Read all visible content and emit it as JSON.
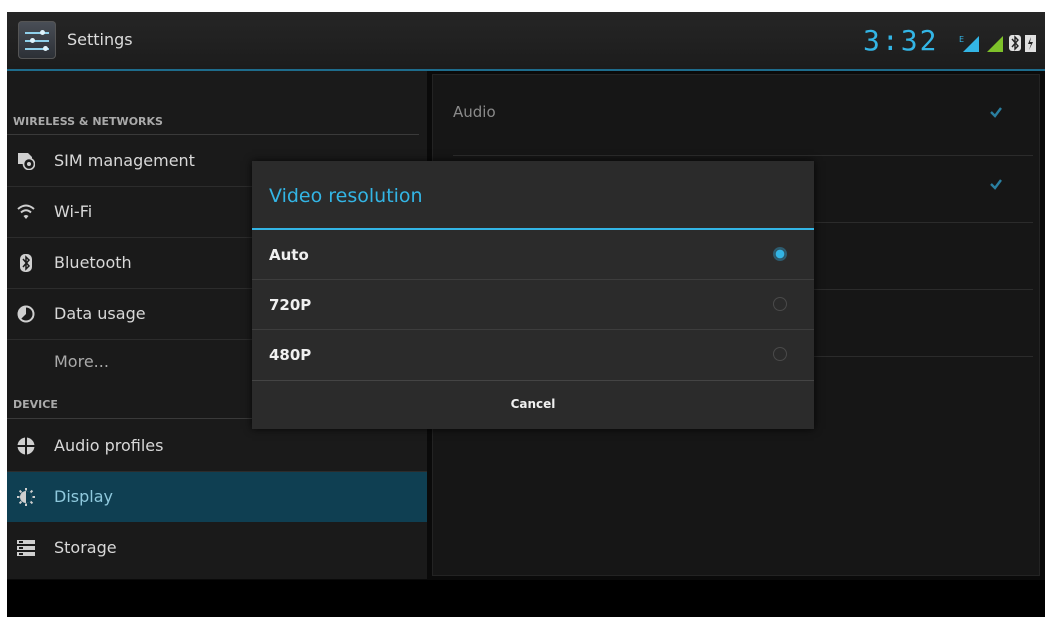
{
  "action_bar": {
    "title": "Settings",
    "clock": "3:32"
  },
  "sidebar": {
    "section_wireless": "WIRELESS & NETWORKS",
    "section_device": "DEVICE",
    "items": [
      {
        "label": "SIM management",
        "icon": "sim-icon"
      },
      {
        "label": "Wi-Fi",
        "icon": "wifi-icon"
      },
      {
        "label": "Bluetooth",
        "icon": "bluetooth-icon"
      },
      {
        "label": "Data usage",
        "icon": "data-usage-icon"
      },
      {
        "label": "More...",
        "icon": ""
      },
      {
        "label": "Audio profiles",
        "icon": "audio-profiles-icon"
      },
      {
        "label": "Display",
        "icon": "display-icon",
        "selected": true
      },
      {
        "label": "Storage",
        "icon": "storage-icon"
      }
    ]
  },
  "content": {
    "rows": [
      {
        "label": "Audio",
        "checked": true
      },
      {
        "label": "",
        "checked": true
      }
    ]
  },
  "dialog": {
    "title": "Video resolution",
    "options": [
      {
        "label": "Auto",
        "selected": true
      },
      {
        "label": "720P",
        "selected": false
      },
      {
        "label": "480P",
        "selected": false
      }
    ],
    "cancel_label": "Cancel"
  },
  "colors": {
    "accent": "#33b5e5",
    "selected_bg": "#0f3f52",
    "status_green": "#7ec12a"
  }
}
